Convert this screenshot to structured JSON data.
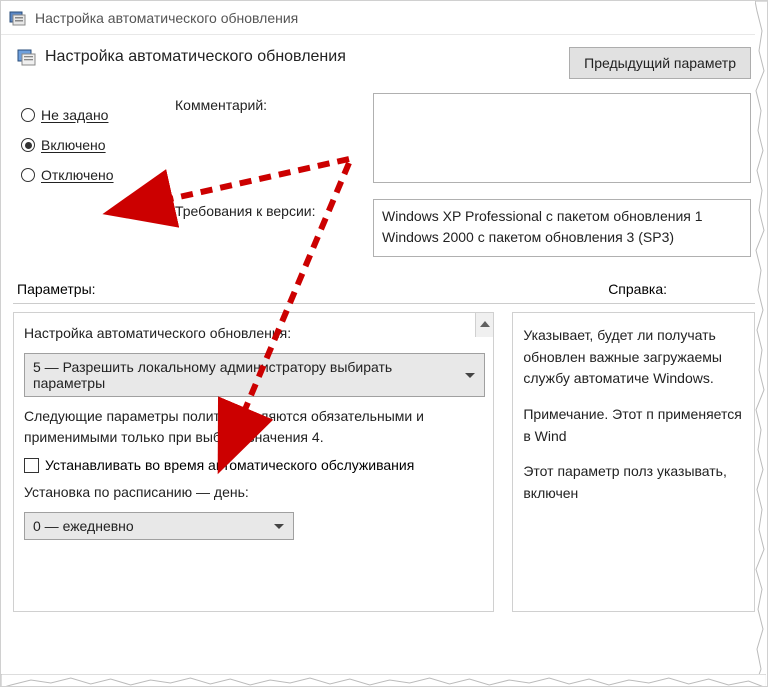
{
  "window": {
    "title": "Настройка автоматического обновления"
  },
  "header": {
    "title": "Настройка автоматического обновления",
    "prev_button": "Предыдущий параметр"
  },
  "radios": {
    "not_configured": "Не задано",
    "enabled": "Включено",
    "disabled": "Отключено"
  },
  "fields": {
    "comment_label": "Комментарий:",
    "requirements_label": "Требования к версии:",
    "requirements_text": "Windows XP Professional с пакетом обновления 1\nWindows 2000 с пакетом обновления 3 (SP3)"
  },
  "section_labels": {
    "parameters": "Параметры:",
    "help": "Справка:"
  },
  "parameters": {
    "heading": "Настройка автоматического обновления:",
    "dropdown_mode": "5 — Разрешить локальному администратору выбирать параметры",
    "note": "Следующие параметры политики являются обязательными и применимыми только при выборе значения 4.",
    "checkbox_label": "Устанавливать во время автоматического обслуживания",
    "schedule_label": "Установка по расписанию — день:",
    "dropdown_day": "0 — ежедневно"
  },
  "help": {
    "p1": "Указывает, будет ли получать обновлен важные загружаемы службу автоматиче Windows.",
    "p2": "Примечание. Этот п применяется в Wind",
    "p3": "Этот параметр полз указывать, включен"
  }
}
